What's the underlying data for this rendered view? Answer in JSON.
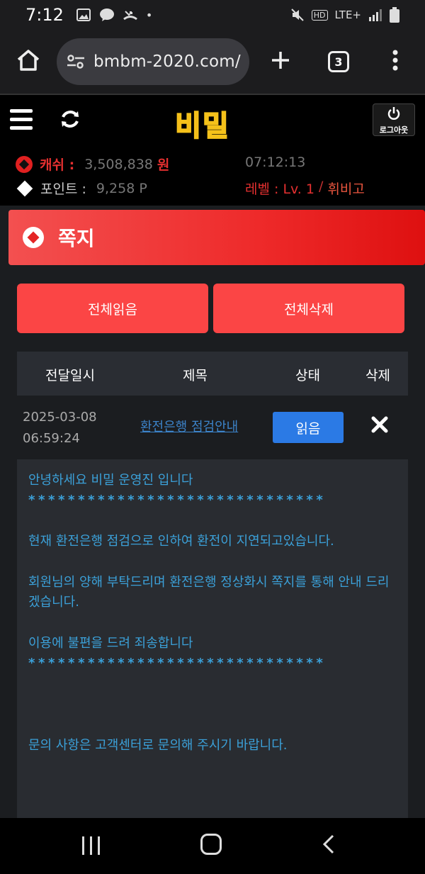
{
  "status_bar": {
    "time": "7:12",
    "network": "LTE+",
    "hd": "HD"
  },
  "browser": {
    "url": "bmbm-2020.com/",
    "tab_count": "3"
  },
  "header": {
    "logo_text": "비밀",
    "logout_label": "로그아웃"
  },
  "account": {
    "cash_label": "캐쉬 :",
    "cash_value": "3,508,838",
    "cash_unit": "원",
    "points_label": "포인트 :",
    "points_value": "9,258 P",
    "clock": "07:12:13",
    "level_label": "레벨 : Lv. 1",
    "level_sep": "/",
    "level_name": "휘비고"
  },
  "page": {
    "title": "쪽지",
    "read_all_label": "전체읽음",
    "delete_all_label": "전체삭제",
    "table_headers": {
      "date": "전달일시",
      "subject": "제목",
      "status": "상태",
      "delete": "삭제"
    },
    "messages": [
      {
        "date": "2025-03-08",
        "time": "06:59:24",
        "subject": "환전은행 점검안내",
        "status_label": "읽음"
      }
    ],
    "message_body": {
      "greeting": "안녕하세요 비밀 운영진 입니다",
      "stars": "******************************",
      "line1": "현재 환전은행 점검으로 인하여 환전이 지연되고있습니다.",
      "line2": "회원님의 양해 부탁드리며 환전은행 정상화시 쪽지를 통해 안내 드리겠습니다.",
      "line3": "이용에 불편을 드려 죄송합니다",
      "line4": "문의 사항은 고객센터로 문의해 주시기 바랍니다."
    }
  },
  "colors": {
    "accent_red": "#fb4545",
    "link_blue": "#3c83c9",
    "read_button": "#2b7ae5",
    "message_text": "#3ba0d8"
  }
}
